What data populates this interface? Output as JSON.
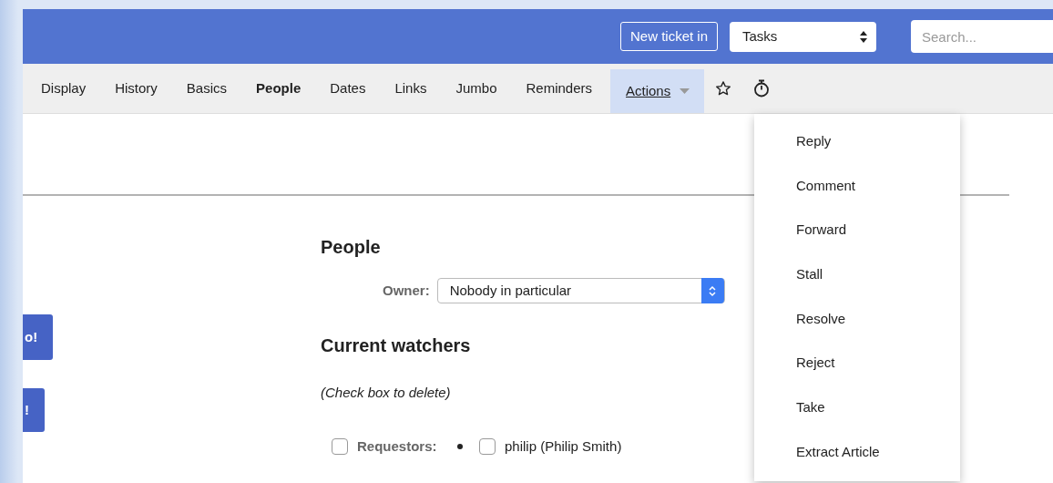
{
  "header": {
    "new_ticket_button": "New ticket in",
    "queue_select": "Tasks",
    "search": {
      "placeholder": "Search..."
    }
  },
  "tabs": [
    {
      "label": "Display",
      "selected": false
    },
    {
      "label": "History",
      "selected": false
    },
    {
      "label": "Basics",
      "selected": false
    },
    {
      "label": "People",
      "selected": true
    },
    {
      "label": "Dates",
      "selected": false
    },
    {
      "label": "Links",
      "selected": false
    },
    {
      "label": "Jumbo",
      "selected": false
    },
    {
      "label": "Reminders",
      "selected": false
    }
  ],
  "actions_menu": {
    "label": "Actions",
    "expanded": true,
    "items": [
      "Reply",
      "Comment",
      "Forward",
      "Stall",
      "Resolve",
      "Reject",
      "Take",
      "Extract Article"
    ]
  },
  "side_buttons": [
    "o!",
    "!"
  ],
  "people": {
    "title": "People",
    "owner_label": "Owner:",
    "owner_value": "Nobody in particular",
    "watchers_title": "Current watchers",
    "hint": "(Check box to delete)",
    "watchers": [
      {
        "label": "Requestors:",
        "checked": false,
        "members": [
          {
            "name": "philip (Philip Smith)",
            "checked": false
          }
        ]
      }
    ]
  }
}
